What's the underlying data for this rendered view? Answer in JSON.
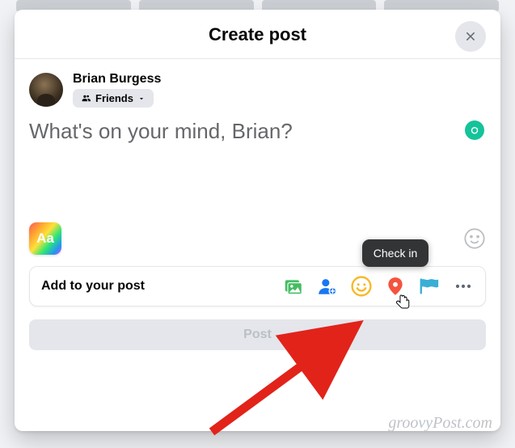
{
  "header": {
    "title": "Create post"
  },
  "author": {
    "name": "Brian Burgess",
    "audience_label": "Friends"
  },
  "composer": {
    "placeholder": "What's on your mind, Brian?",
    "bg_selector_label": "Aa"
  },
  "add_bar": {
    "label": "Add to your post",
    "tooltip": "Check in"
  },
  "post_button": {
    "label": "Post"
  },
  "watermark": "groovyPost.com"
}
